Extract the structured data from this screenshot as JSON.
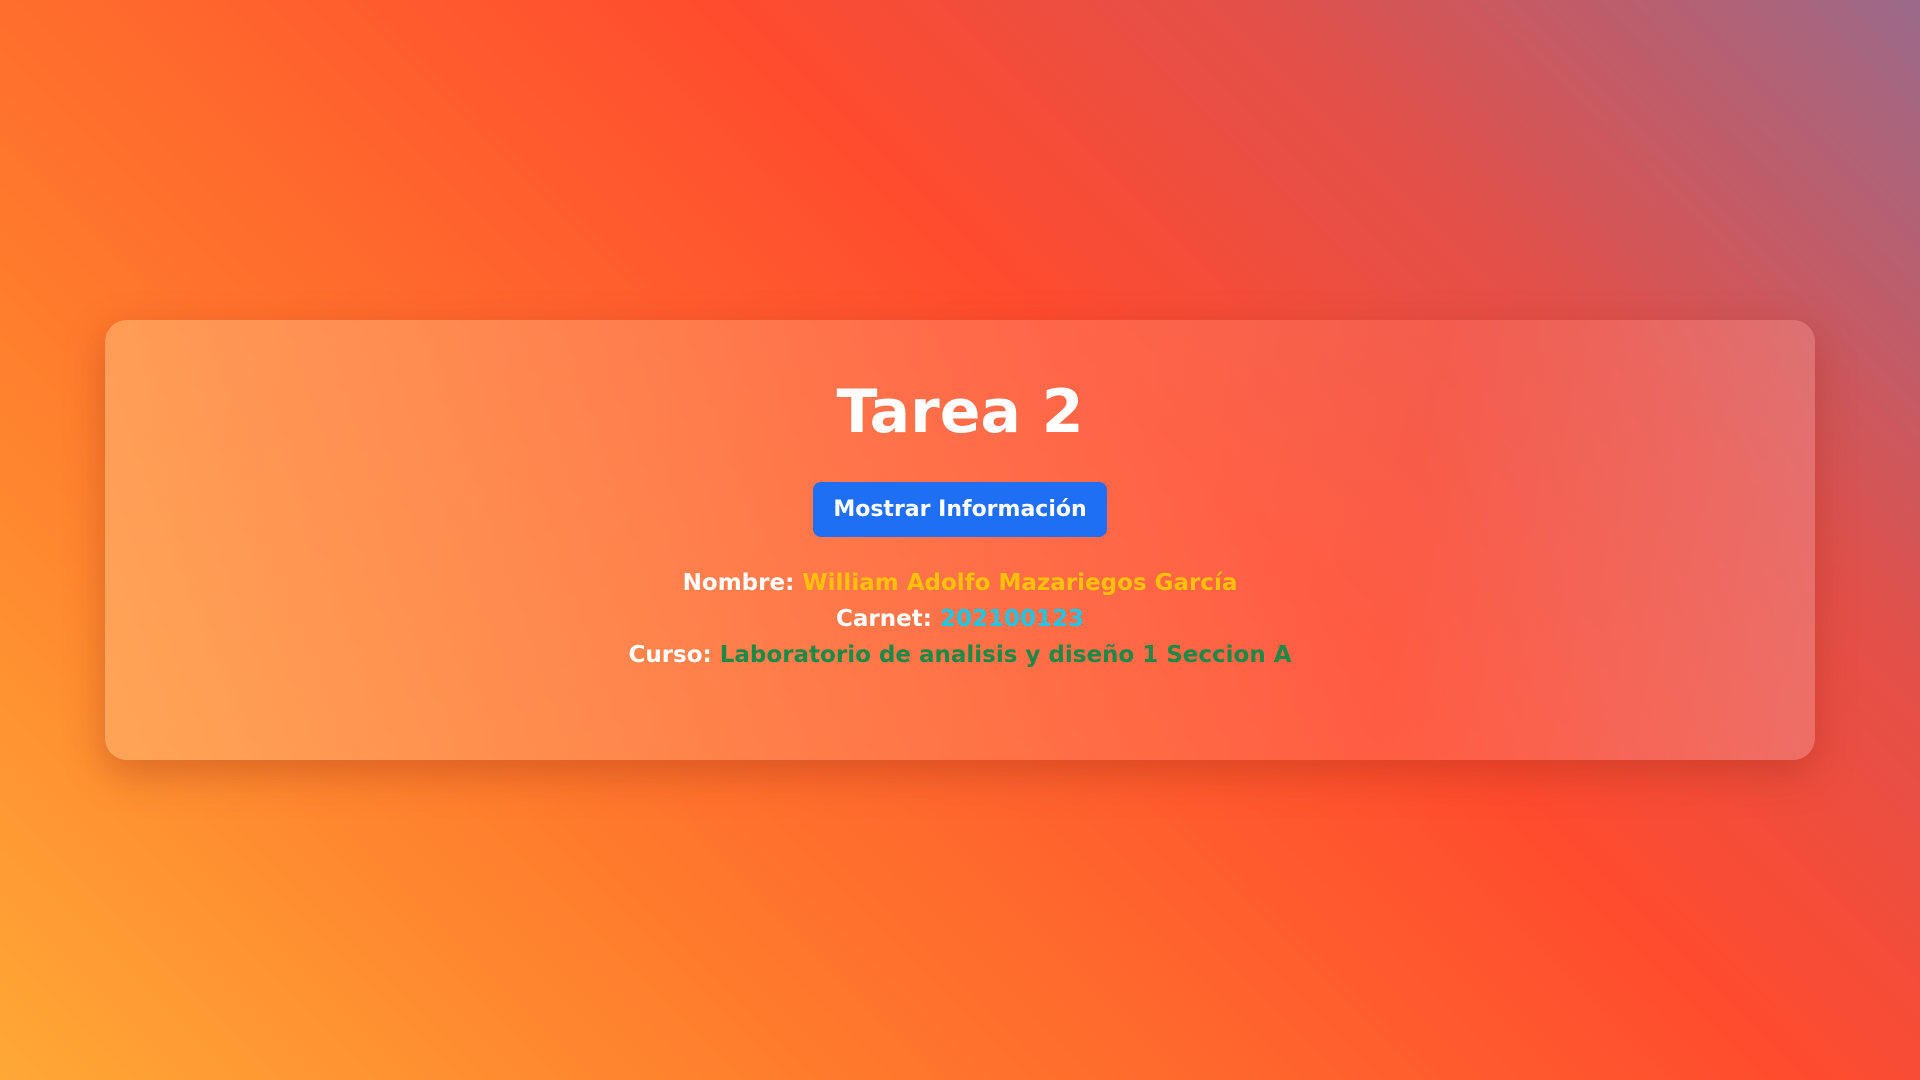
{
  "card": {
    "title": "Tarea 2",
    "button_label": "Mostrar Información"
  },
  "info": {
    "nombre_label": "Nombre:",
    "nombre_value": "William Adolfo Mazariegos García",
    "carnet_label": "Carnet:",
    "carnet_value": "202100123",
    "curso_label": "Curso:",
    "curso_value": "Laboratorio de analisis y diseño 1 Seccion A"
  },
  "colors": {
    "button_bg": "#1f6ff5",
    "nombre_value": "#ffc107",
    "carnet_value": "#20c6e6",
    "curso_value": "#1b8a47"
  }
}
